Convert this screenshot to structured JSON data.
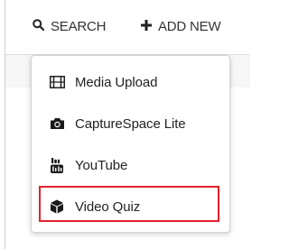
{
  "toolbar": {
    "search_label": "SEARCH",
    "search_icon": "search-icon",
    "add_new_label": "ADD NEW",
    "add_new_icon": "plus-icon"
  },
  "menu": {
    "items": [
      {
        "label": "Media Upload",
        "icon": "film-icon"
      },
      {
        "label": "CaptureSpace Lite",
        "icon": "camera-icon"
      },
      {
        "label": "YouTube",
        "icon": "youtube-icon"
      },
      {
        "label": "Video Quiz",
        "icon": "cube-icon",
        "highlighted": true
      }
    ]
  },
  "colors": {
    "highlight_border": "#e4202b",
    "text": "#222222"
  }
}
